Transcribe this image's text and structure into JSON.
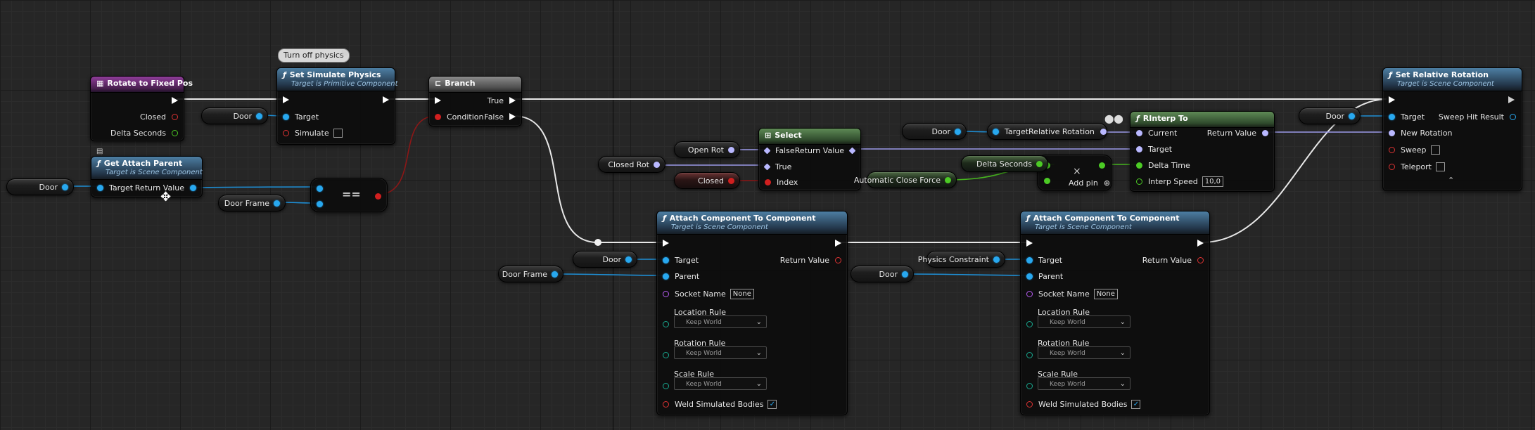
{
  "comment": {
    "text": "Turn off physics"
  },
  "nodes": {
    "rotate_to_fixed_pos": {
      "title": "Rotate to Fixed Pos",
      "pins": {
        "closed": "Closed",
        "delta_seconds": "Delta Seconds"
      }
    },
    "get_attach_parent": {
      "title": "Get Attach Parent",
      "subtitle": "Target is Scene Component",
      "pins": {
        "target": "Target",
        "return_value": "Return Value"
      }
    },
    "set_simulate_physics": {
      "title": "Set Simulate Physics",
      "subtitle": "Target is Primitive Component",
      "pins": {
        "target": "Target",
        "simulate": "Simulate"
      }
    },
    "equals": {
      "symbol": "=="
    },
    "branch": {
      "title": "Branch",
      "pins": {
        "true": "True",
        "condition": "Condition",
        "false": "False"
      }
    },
    "select": {
      "title": "Select",
      "pins": {
        "false": "False",
        "true": "True",
        "index": "Index",
        "return_value": "Return Value"
      }
    },
    "rinterp_to": {
      "title": "RInterp To",
      "pins": {
        "current": "Current",
        "target": "Target",
        "delta_time": "Delta Time",
        "interp_speed": "Interp Speed",
        "interp_speed_value": "10,0",
        "return_value": "Return Value"
      }
    },
    "add": {
      "symbol": "×",
      "add_pin": "Add pin"
    },
    "set_relative_rotation": {
      "title": "Set Relative Rotation",
      "subtitle": "Target is Scene Component",
      "pins": {
        "target": "Target",
        "new_rotation": "New Rotation",
        "sweep": "Sweep",
        "teleport": "Teleport",
        "sweep_hit_result": "Sweep Hit Result"
      }
    },
    "attach_1": {
      "title": "Attach Component To Component",
      "subtitle": "Target is Scene Component",
      "pins": {
        "target": "Target",
        "parent": "Parent",
        "socket_name": "Socket Name",
        "socket_value": "None",
        "return_value": "Return Value",
        "location_rule": "Location Rule",
        "rotation_rule": "Rotation Rule",
        "scale_rule": "Scale Rule",
        "weld": "Weld Simulated Bodies"
      },
      "rules": {
        "location": "Keep World",
        "rotation": "Keep World",
        "scale": "Keep World"
      }
    },
    "attach_2": {
      "title": "Attach Component To Component",
      "subtitle": "Target is Scene Component",
      "pins": {
        "target": "Target",
        "parent": "Parent",
        "socket_name": "Socket Name",
        "socket_value": "None",
        "return_value": "Return Value",
        "location_rule": "Location Rule",
        "rotation_rule": "Rotation Rule",
        "scale_rule": "Scale Rule",
        "weld": "Weld Simulated Bodies"
      },
      "rules": {
        "location": "Keep World",
        "rotation": "Keep World",
        "scale": "Keep World"
      }
    }
  },
  "variables": {
    "door_1": "Door",
    "door_2": "Door",
    "door_frame_1": "Door Frame",
    "open_rot": "Open Rot",
    "closed_rot": "Closed Rot",
    "closed": "Closed",
    "door_3": "Door",
    "door_frame_2": "Door Frame",
    "door_4": "Door",
    "target_relrot": "Target",
    "relative_rotation": "Relative Rotation",
    "delta_seconds": "Delta Seconds",
    "auto_close_force": "Automatic Close Force",
    "physics_constraint": "Physics Constraint",
    "door_5": "Door",
    "door_6": "Door"
  },
  "colors": {
    "exec_wire": "#e8e8e8",
    "object_wire": "#1e8fd6",
    "bool_wire": "#8c1717",
    "float_wire": "#46b51e",
    "rotator_wire": "#9c9ae8"
  }
}
